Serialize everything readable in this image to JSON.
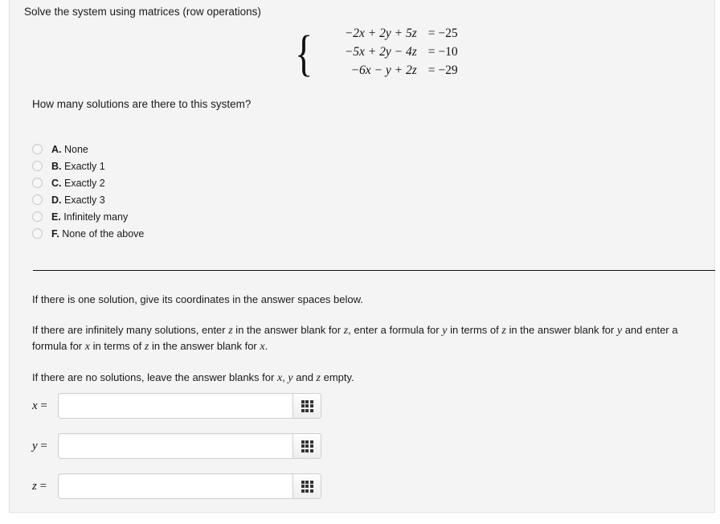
{
  "prompt": {
    "title": "Solve the system using matrices (row operations)",
    "question": "How many solutions are there to this system?"
  },
  "system": {
    "brace": "{",
    "equations": [
      {
        "lhs": "−2x + 2y + 5z",
        "rhs": "= −25"
      },
      {
        "lhs": "−5x + 2y − 4z",
        "rhs": "= −10"
      },
      {
        "lhs": "−6x − y + 2z",
        "rhs": "= −29"
      }
    ]
  },
  "choices": [
    {
      "letter": "A.",
      "text": "None",
      "selected": false
    },
    {
      "letter": "B.",
      "text": "Exactly 1",
      "selected": false
    },
    {
      "letter": "C.",
      "text": "Exactly 2",
      "selected": false
    },
    {
      "letter": "D.",
      "text": "Exactly 3",
      "selected": false
    },
    {
      "letter": "E.",
      "text": "Infinitely many",
      "selected": false
    },
    {
      "letter": "F.",
      "text": "None of the above",
      "selected": false
    }
  ],
  "instructions": {
    "p1": "If there is one solution, give its coordinates in the answer spaces below.",
    "p2_part1": "If there are infinitely many solutions, enter ",
    "p2_var1": "z",
    "p2_part2": " in the answer blank for ",
    "p2_var2": "z",
    "p2_part3": ", enter a formula for ",
    "p2_var3": "y",
    "p2_part4": " in terms of ",
    "p2_var4": "z",
    "p2_part5": " in the answer blank for ",
    "p2_var5": "y",
    "p2_part6": " and enter a formula for ",
    "p2_var6": "x",
    "p2_part7": " in terms of ",
    "p2_var7": "z",
    "p2_part8": " in the answer blank for ",
    "p2_var8": "x",
    "p2_part9": ".",
    "p3_part1": "If there are no solutions, leave the answer blanks for ",
    "p3_var1": "x",
    "p3_part2": ", ",
    "p3_var2": "y",
    "p3_part3": " and ",
    "p3_var3": "z",
    "p3_part4": " empty."
  },
  "answers": [
    {
      "label_var": "x",
      "label_eq": " =",
      "value": "",
      "placeholder": "",
      "keypad_icon": "grid-keypad-icon"
    },
    {
      "label_var": "y",
      "label_eq": " =",
      "value": "",
      "placeholder": "",
      "keypad_icon": "grid-keypad-icon"
    },
    {
      "label_var": "z",
      "label_eq": " =",
      "value": "",
      "placeholder": "",
      "keypad_icon": "grid-keypad-icon"
    }
  ],
  "colors": {
    "panel_background": "#f4f4f4",
    "page_background": "#ffffff",
    "text": "#1a1a1a",
    "divider": "#111111",
    "input_border": "#cfcfcf"
  }
}
